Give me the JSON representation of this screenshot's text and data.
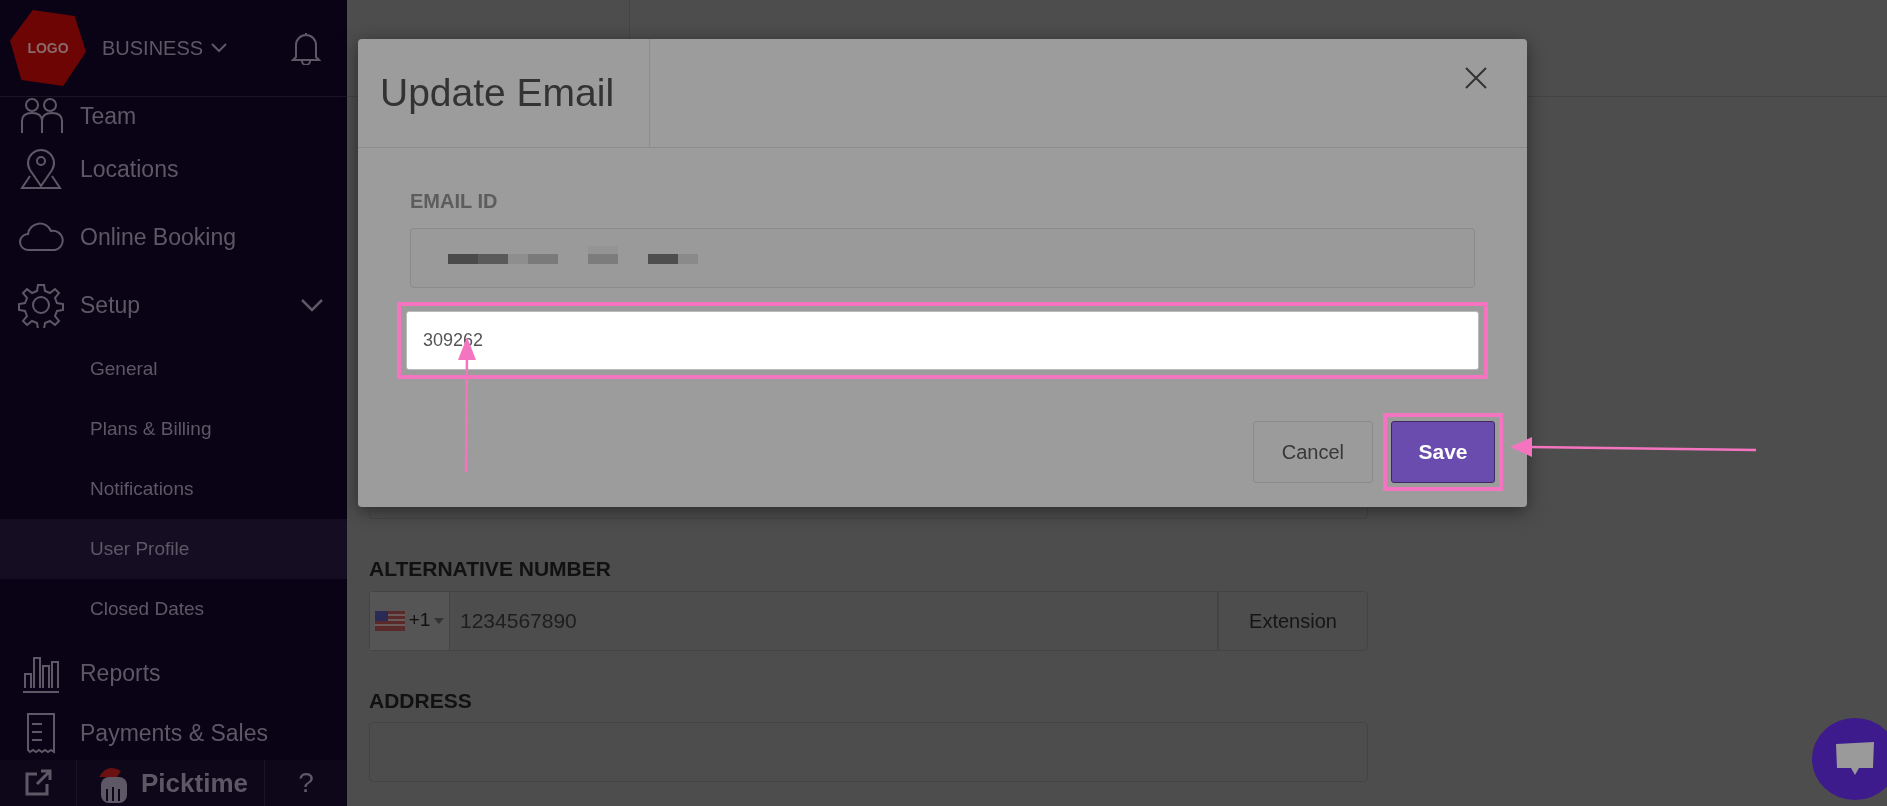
{
  "sidebar": {
    "logo": "LOGO",
    "business": "BUSINESS",
    "items": [
      {
        "label": "Team",
        "selected": false
      },
      {
        "label": "Locations",
        "selected": false
      },
      {
        "label": "Online Booking",
        "selected": false
      },
      {
        "label": "Setup",
        "selected": false,
        "expanded": true,
        "children": [
          {
            "label": "General",
            "selected": false
          },
          {
            "label": "Plans & Billing",
            "selected": false
          },
          {
            "label": "Notifications",
            "selected": false
          },
          {
            "label": "User Profile",
            "selected": true
          },
          {
            "label": "Closed Dates",
            "selected": false
          }
        ]
      },
      {
        "label": "Reports",
        "selected": false
      },
      {
        "label": "Payments & Sales",
        "selected": false
      }
    ],
    "footer": {
      "brand": "Picktime",
      "help": "?"
    }
  },
  "form": {
    "fields": [
      {
        "kind": "text"
      },
      {
        "kind": "phone",
        "label": "ALTERNATIVE NUMBER",
        "dial_code": "+1",
        "value": "1234567890",
        "extension_placeholder": "Extension"
      },
      {
        "kind": "text",
        "label": "ADDRESS"
      }
    ]
  },
  "modal": {
    "title": "Update Email",
    "email_label": "EMAIL ID",
    "code_value": "309262",
    "code_highlighted": true,
    "buttons": [
      {
        "label": "Cancel",
        "kind": "secondary",
        "highlighted": false
      },
      {
        "label": "Save",
        "kind": "primary",
        "highlighted": true
      }
    ]
  }
}
